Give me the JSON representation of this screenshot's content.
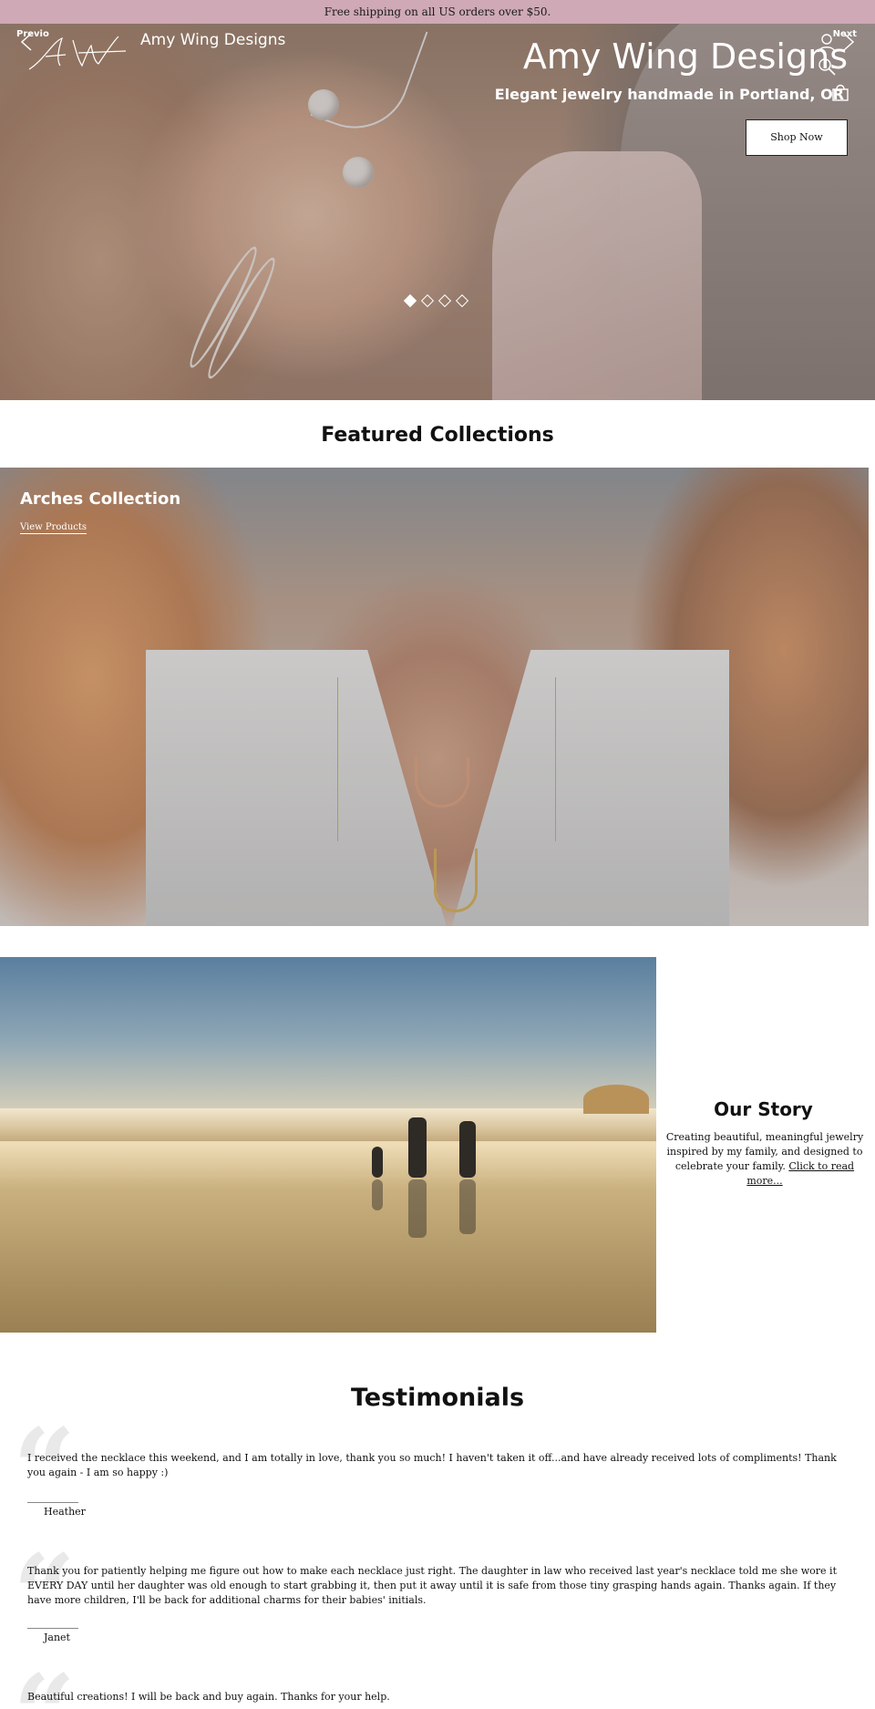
{
  "announcement": "Free shipping on all US orders over $50.",
  "header": {
    "brand_name": "Amy Wing Designs",
    "logo_text": "AW"
  },
  "hero": {
    "prev_label": "Previo",
    "next_label": "Next",
    "title": "Amy Wing Designs",
    "subtitle": "Elegant jewelry handmade in Portland, OR",
    "cta_label": "Shop Now",
    "slide_count": 4,
    "active_slide": 1
  },
  "featured": {
    "title": "Featured Collections",
    "collection_title": "Arches Collection",
    "collection_link": "View Products"
  },
  "story": {
    "title": "Our Story",
    "text": "Creating beautiful, meaningful jewelry inspired by my family, and designed to celebrate your family.",
    "link": "Click to read more..."
  },
  "testimonials": {
    "title": "Testimonials",
    "items": [
      {
        "text": "I received the necklace this weekend, and I am totally in love, thank you so much! I haven't taken it off...and have already received lots of compliments! Thank you again - I am so happy :)",
        "author": "Heather"
      },
      {
        "text": "Thank you for patiently helping me figure out how to make each necklace just right. The daughter in law who received last year's necklace told me she wore it EVERY DAY until her daughter was old enough to start grabbing it, then put it away until it is safe from those tiny grasping hands again. Thanks again. If they have more children, I'll be back for additional charms for their babies' initials.",
        "author": "Janet"
      },
      {
        "text": "Beautiful creations! I will be back and buy again. Thanks for your help.",
        "author": ""
      }
    ]
  },
  "colors": {
    "announcement_bg": "#cfa9b5",
    "text": "#111111",
    "quote_mark": "#e9e9e9"
  },
  "icons": [
    "user-icon",
    "search-icon",
    "cart-icon",
    "chevron-left-icon",
    "chevron-right-icon",
    "quote-icon"
  ]
}
